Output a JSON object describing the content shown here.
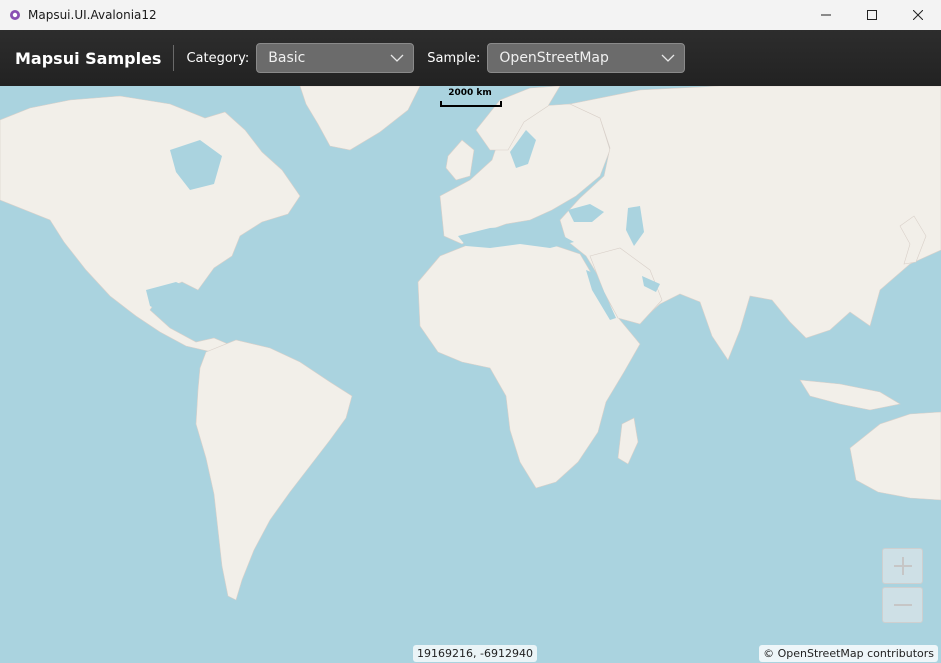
{
  "window": {
    "title": "Mapsui.UI.Avalonia12",
    "controls": [
      "minimize-icon",
      "maximize-icon",
      "close-icon"
    ]
  },
  "toolbar": {
    "brand": "Mapsui Samples",
    "category_label": "Category:",
    "category_value": "Basic",
    "sample_label": "Sample:",
    "sample_value": "OpenStreetMap"
  },
  "map": {
    "scale_label": "2000 km",
    "coordinates": "19169216, -6912940",
    "attribution": "© OpenStreetMap contributors",
    "zoom_in": "+",
    "zoom_out": "−"
  },
  "colors": {
    "water": "#aad3df",
    "land": "#f2efe9",
    "toolbar_bg": "#262626",
    "accent": "#8a4fb3"
  }
}
